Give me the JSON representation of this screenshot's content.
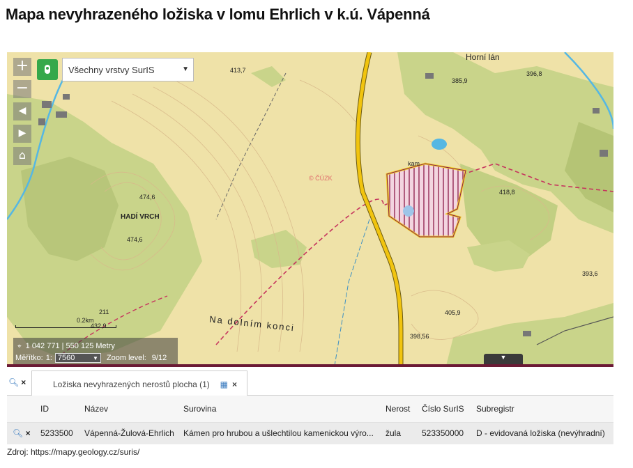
{
  "page": {
    "title": "Mapa nevyhrazeného ložiska v lomu Ehrlich v k.ú. Vápenná"
  },
  "map": {
    "layer_select": "Všechny vrstvy SurIS",
    "zoom_in": "+",
    "zoom_out": "−",
    "labels": {
      "hadi_vrch": "HADÍ VRCH",
      "dolni_konec": "Na dolním konci",
      "cuzk": "© ČÚZK",
      "horni_lan": "Horní lán",
      "kamen": "kam",
      "e4136": "413,7",
      "e3968": "396,8",
      "e3859": "385,9",
      "e4188": "418,8",
      "e3936": "393,6",
      "e4059": "405,9",
      "e39856": "398,56",
      "e4746a": "474,6",
      "e4746b": "474,6",
      "e4329": "432,9",
      "e211": "211",
      "scale_km": "0.2km"
    },
    "coordinates": "1 042 771 | 550 125 Metry",
    "scale_label": "Měřítko:",
    "scale_prefix": "1:",
    "scale_value": "7560",
    "zoom_level_label": "Zoom level:",
    "zoom_level_value": "9/12"
  },
  "tabs": {
    "active_tab": "Ložiska nevyhrazených nerostů plocha (1)"
  },
  "table": {
    "columns": [
      "ID",
      "Název",
      "Surovina",
      "Nerost",
      "Číslo SurIS",
      "Subregistr"
    ],
    "rows": [
      [
        "5233500",
        "Vápenná-Žulová-Ehrlich",
        "Kámen pro hrubou a ušlechtilou kamenickou výro...",
        "žula",
        "523350000",
        "D - evidovaná ložiska (nevýhradní)"
      ]
    ]
  },
  "source": "Zdroj: https://mapy.geology.cz/suris/",
  "colors": {
    "map_base": "#efe2a8",
    "forest": "#c9d48a",
    "forest_dark": "#a9ba6e",
    "road": "#f1c40f",
    "deposit_outline": "#f2d22e",
    "deposit_hatch": "#8b1a4a",
    "layer_button": "#35a84a"
  }
}
